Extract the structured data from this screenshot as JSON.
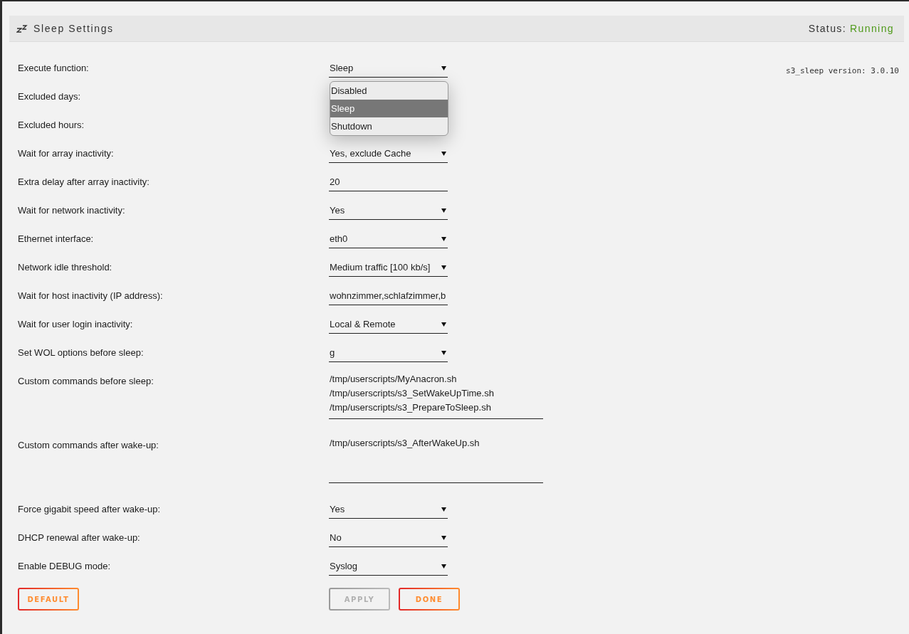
{
  "header": {
    "title": "Sleep Settings",
    "status_label": "Status:",
    "status_value": "Running"
  },
  "version": "s3_sleep version: 3.0.10",
  "rows": [
    {
      "label": "Execute function:",
      "kind": "select",
      "value": "Sleep",
      "open": true,
      "options": [
        {
          "label": "Disabled",
          "selected": false
        },
        {
          "label": "Sleep",
          "selected": true
        },
        {
          "label": "Shutdown",
          "selected": false
        }
      ]
    },
    {
      "label": "Excluded days:",
      "kind": "covered"
    },
    {
      "label": "Excluded hours:",
      "kind": "covered"
    },
    {
      "label": "Wait for array inactivity:",
      "kind": "select",
      "value": "Yes, exclude Cache"
    },
    {
      "label": "Extra delay after array inactivity:",
      "kind": "input",
      "value": "20"
    },
    {
      "label": "Wait for network inactivity:",
      "kind": "select",
      "value": "Yes"
    },
    {
      "label": "Ethernet interface:",
      "kind": "select",
      "value": "eth0"
    },
    {
      "label": "Network idle threshold:",
      "kind": "select",
      "value": "Medium traffic [100 kb/s]"
    },
    {
      "label": "Wait for host inactivity (IP address):",
      "kind": "input",
      "value": "wohnzimmer,schlafzimmer,b"
    },
    {
      "label": "Wait for user login inactivity:",
      "kind": "select",
      "value": "Local & Remote"
    },
    {
      "label": "Set WOL options before sleep:",
      "kind": "select",
      "value": "g"
    },
    {
      "label": "Custom commands before sleep:",
      "kind": "textarea",
      "lines": [
        "/tmp/userscripts/MyAnacron.sh",
        "/tmp/userscripts/s3_SetWakeUpTime.sh",
        "/tmp/userscripts/s3_PrepareToSleep.sh"
      ]
    },
    {
      "label": "Custom commands after wake-up:",
      "kind": "textarea",
      "lines": [
        "/tmp/userscripts/s3_AfterWakeUp.sh"
      ]
    },
    {
      "label": "Force gigabit speed after wake-up:",
      "kind": "select",
      "value": "Yes"
    },
    {
      "label": "DHCP renewal after wake-up:",
      "kind": "select",
      "value": "No"
    },
    {
      "label": "Enable DEBUG mode:",
      "kind": "select",
      "value": "Syslog"
    }
  ],
  "buttons": {
    "default": {
      "label": "DEFAULT",
      "disabled": false
    },
    "apply": {
      "label": "APPLY",
      "disabled": true
    },
    "done": {
      "label": "DONE",
      "disabled": false
    }
  }
}
